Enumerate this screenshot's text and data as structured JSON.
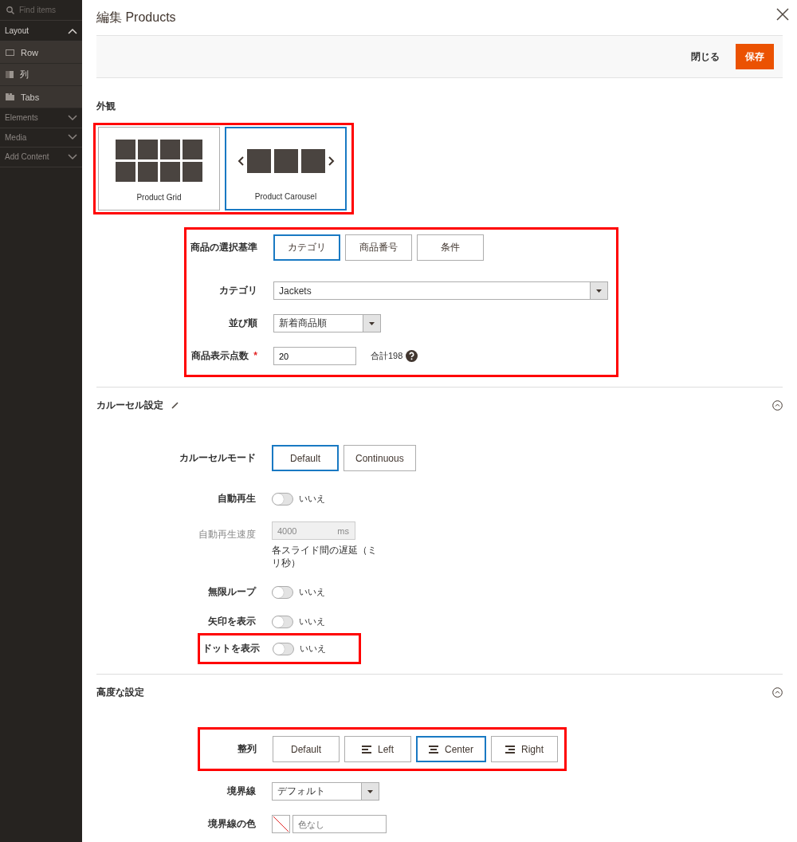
{
  "sidebar": {
    "search": {
      "placeholder": "Find items"
    },
    "groups": [
      {
        "label": "Layout",
        "expanded": true,
        "items": [
          {
            "label": "Row",
            "kind": "row"
          },
          {
            "label": "列",
            "kind": "column"
          },
          {
            "label": "Tabs",
            "kind": "tabs"
          }
        ]
      },
      {
        "label": "Elements",
        "expanded": false
      },
      {
        "label": "Media",
        "expanded": false
      },
      {
        "label": "Add Content",
        "expanded": false
      }
    ]
  },
  "modal": {
    "title": "編集 Products",
    "actions": [
      {
        "label": "閉じる",
        "kind": "secondary"
      },
      {
        "label": "保存",
        "kind": "primary"
      }
    ]
  },
  "appearance": {
    "title": "外観",
    "highlighted": true,
    "options": [
      {
        "label": "Product Grid",
        "kind": "grid",
        "selected": false
      },
      {
        "label": "Product Carousel",
        "kind": "carousel",
        "selected": true
      }
    ]
  },
  "sections": [
    {
      "groups": [
        {
          "highlighted": true,
          "fields": [
            {
              "kind": "segmented",
              "label": "商品の選択基準",
              "options": [
                {
                  "label": "カテゴリ",
                  "kind": "plain",
                  "selected": true
                },
                {
                  "label": "商品番号",
                  "kind": "plain",
                  "selected": false
                },
                {
                  "label": "条件",
                  "kind": "plain",
                  "selected": false
                }
              ]
            },
            {
              "kind": "select",
              "label": "カテゴリ",
              "value": "Jackets",
              "wide": true
            },
            {
              "kind": "select",
              "label": "並び順",
              "value": "新着商品順",
              "wide": false
            },
            {
              "kind": "number",
              "label": "商品表示点数",
              "required_mark": "*",
              "value": "20",
              "note": "合計198"
            }
          ]
        }
      ]
    },
    {
      "title": "カルーセル設定",
      "editable": true,
      "expanded": true,
      "groups": [
        {
          "highlighted": false,
          "fields": [
            {
              "kind": "segmented",
              "label": "カルーセルモード",
              "options": [
                {
                  "label": "Default",
                  "kind": "plain",
                  "selected": true
                },
                {
                  "label": "Continuous",
                  "kind": "plain",
                  "selected": false
                }
              ]
            },
            {
              "kind": "toggle",
              "label": "自動再生",
              "on": false,
              "state": "いいえ"
            },
            {
              "kind": "unit",
              "label": "自動再生速度",
              "disabled": true,
              "value": "4000",
              "unit": "ms",
              "note": "各スライド間の遅延（ミリ秒）"
            },
            {
              "kind": "toggle",
              "label": "無限ループ",
              "on": false,
              "state": "いいえ"
            },
            {
              "kind": "toggle",
              "label": "矢印を表示",
              "on": false,
              "state": "いいえ"
            }
          ]
        },
        {
          "highlighted": true,
          "fields": [
            {
              "kind": "toggle",
              "label": "ドットを表示",
              "on": false,
              "state": "いいえ"
            }
          ]
        }
      ]
    },
    {
      "title": "高度な設定",
      "editable": false,
      "expanded": true,
      "groups": [
        {
          "highlighted": true,
          "fields": [
            {
              "kind": "segmented",
              "label": "整列",
              "options": [
                {
                  "label": "Default",
                  "kind": "plain",
                  "selected": false
                },
                {
                  "label": "Left",
                  "kind": "align-left",
                  "selected": false
                },
                {
                  "label": "Center",
                  "kind": "align-center",
                  "selected": true
                },
                {
                  "label": "Right",
                  "kind": "align-right",
                  "selected": false
                }
              ]
            }
          ]
        },
        {
          "highlighted": false,
          "fields": [
            {
              "kind": "select",
              "label": "境界線",
              "value": "デフォルト",
              "wide": false
            },
            {
              "kind": "color",
              "label": "境界線の色",
              "placeholder": "色なし"
            }
          ]
        }
      ]
    }
  ]
}
